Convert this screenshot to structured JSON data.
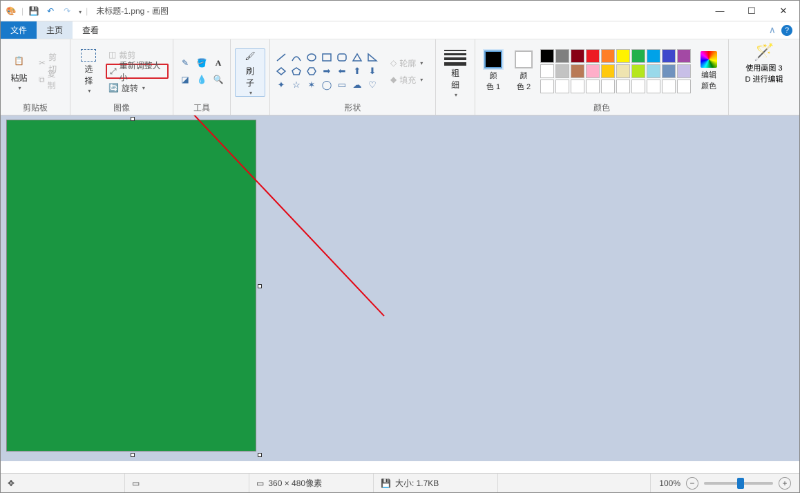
{
  "title": "未标题-1.png - 画图",
  "tabs": {
    "file": "文件",
    "home": "主页",
    "view": "查看"
  },
  "groups": {
    "clipboard": {
      "label": "剪贴板",
      "paste": "粘贴",
      "cut": "剪切",
      "copy": "复制"
    },
    "image": {
      "label": "图像",
      "select": "选\n择",
      "crop": "裁剪",
      "resize": "重新调整大小",
      "rotate": "旋转"
    },
    "tools": {
      "label": "工具"
    },
    "brush": {
      "label": "刷\n子"
    },
    "shapes": {
      "label": "形状",
      "outline": "轮廓",
      "fill": "填充"
    },
    "thickness": {
      "label": "粗\n细"
    },
    "colors": {
      "label": "颜色",
      "c1": "颜\n色 1",
      "c2": "颜\n色 2",
      "edit": "编辑\n颜色"
    },
    "paint3d": {
      "label": "使用画图 3\nD 进行编辑"
    }
  },
  "palette_row1": [
    "#000000",
    "#7f7f7f",
    "#880015",
    "#ed1c24",
    "#ff7f27",
    "#fff200",
    "#22b14c",
    "#00a2e8",
    "#3f48cc",
    "#a349a4"
  ],
  "palette_row2": [
    "#ffffff",
    "#c3c3c3",
    "#b97a57",
    "#ffaec9",
    "#ffc90e",
    "#efe4b0",
    "#b5e61d",
    "#99d9ea",
    "#7092be",
    "#c8bfe7"
  ],
  "palette_row3": [
    "#fff",
    "#fff",
    "#fff",
    "#fff",
    "#fff",
    "#fff",
    "#fff",
    "#fff",
    "#fff",
    "#fff"
  ],
  "status": {
    "dims": "360 × 480像素",
    "size": "大小: 1.7KB",
    "zoom": "100%"
  }
}
